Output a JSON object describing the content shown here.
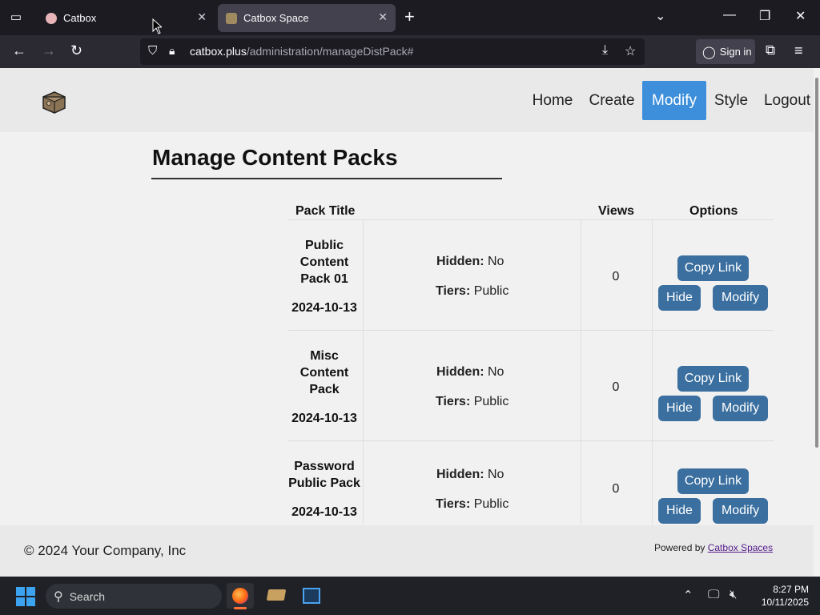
{
  "browser": {
    "tabs": [
      {
        "title": "Catbox",
        "active": false
      },
      {
        "title": "Catbox Space",
        "active": true
      }
    ],
    "url_host": "catbox.plus",
    "url_path": "/administration/manageDistPack#",
    "sign_in": "Sign in"
  },
  "site": {
    "nav": [
      {
        "label": "Home",
        "active": false
      },
      {
        "label": "Create",
        "active": false
      },
      {
        "label": "Modify",
        "active": true
      },
      {
        "label": "Style",
        "active": false
      },
      {
        "label": "Logout",
        "active": false
      }
    ],
    "accent_color": "#3d8fdc",
    "button_color": "#3a6f9f"
  },
  "page": {
    "title": "Manage Content Packs",
    "columns": {
      "pack_title": "Pack Title",
      "views": "Views",
      "options": "Options"
    },
    "labels": {
      "hidden": "Hidden:",
      "tiers": "Tiers:"
    },
    "buttons": {
      "copy_link": "Copy Link",
      "hide": "Hide",
      "modify": "Modify"
    },
    "packs": [
      {
        "title": "Public Content Pack 01",
        "date": "2024-10-13",
        "hidden": "No",
        "tiers": "Public",
        "views": "0"
      },
      {
        "title": "Misc Content Pack",
        "date": "2024-10-13",
        "hidden": "No",
        "tiers": "Public",
        "views": "0"
      },
      {
        "title": "Password Public Pack",
        "date": "2024-10-13",
        "hidden": "No",
        "tiers": "Public",
        "views": "0"
      }
    ]
  },
  "footer": {
    "copyright": "© 2024 Your Company, Inc",
    "powered_prefix": "Powered by",
    "powered_link": "Catbox Spaces"
  },
  "taskbar": {
    "search_placeholder": "Search",
    "time": "8:27 PM",
    "date": "10/11/2025"
  }
}
